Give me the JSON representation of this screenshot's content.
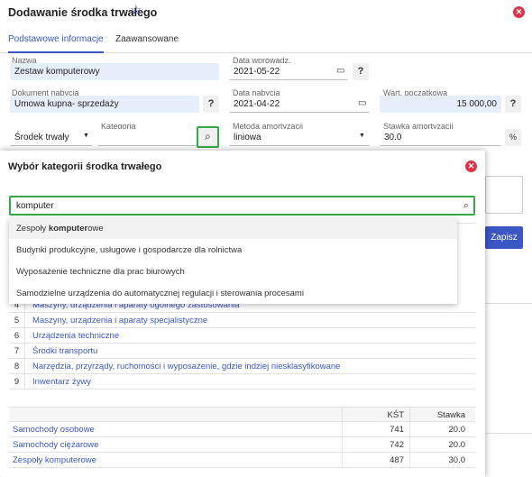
{
  "header": {
    "title": "Dodawanie środka trwałego"
  },
  "tabs": [
    "Podstawowe informacje",
    "Zaawansowane"
  ],
  "form": {
    "nazwa": {
      "label": "Nazwa",
      "value": "Zestaw komputerowy"
    },
    "data_wprowadz": {
      "label": "Data wprowadz.",
      "value": "2021-05-22"
    },
    "dokument": {
      "label": "Dokument nabycia",
      "value": "Umowa kupna- sprzedaży"
    },
    "data_nabycia": {
      "label": "Data nabycia",
      "value": "2021-04-22"
    },
    "wart": {
      "label": "Wart. początkowa",
      "value": "15 000,00"
    },
    "typ": {
      "value": "Środek trwały"
    },
    "kategoria": {
      "label": "Kategoria",
      "value": ""
    },
    "metoda": {
      "label": "Metoda amortyzacji",
      "value": "liniowa"
    },
    "stawka": {
      "label": "Stawka amortyzacji",
      "value": "30.0",
      "unit": "%"
    },
    "question": "?"
  },
  "save_label": "Zapisz",
  "modal": {
    "title": "Wybór kategorii środka trwałego",
    "search_value": "komputer",
    "suggestions": [
      {
        "prefix": "Zespoły ",
        "match": "komputer",
        "suffix": "owe"
      },
      {
        "prefix": "Budynki produkcyjne, usługowe i gospodarcze dla rolnictwa",
        "match": "",
        "suffix": ""
      },
      {
        "prefix": "Wyposażenie techniczne dla prac biurowych",
        "match": "",
        "suffix": ""
      },
      {
        "prefix": "Samodzielne urządzenia do automatycznej regulacji i sterowania procesami",
        "match": "",
        "suffix": ""
      }
    ],
    "categories": [
      {
        "num": "4",
        "name": "Maszyny, urządzenia i aparaty ogólnego zastosowania"
      },
      {
        "num": "5",
        "name": "Maszyny, urządzenia i aparaty specjalistyczne"
      },
      {
        "num": "6",
        "name": "Urządzenia techniczne"
      },
      {
        "num": "7",
        "name": "Środki transportu"
      },
      {
        "num": "8",
        "name": "Narzędzia, przyrządy, ruchomości i wyposażenie, gdzie indziej niesklasyfikowane"
      },
      {
        "num": "9",
        "name": "Inwentarz żywy"
      }
    ],
    "results_header": {
      "kst": "KŚT",
      "stawka": "Stawka"
    },
    "results": [
      {
        "name": "Samochody osobowe",
        "kst": "741",
        "stawka": "20.0"
      },
      {
        "name": "Samochody ciężarowe",
        "kst": "742",
        "stawka": "20.0"
      },
      {
        "name": "Zespoły komputerowe",
        "kst": "487",
        "stawka": "30.0"
      }
    ]
  },
  "colors": {
    "accent": "#3a57c4",
    "highlight": "#35a94a",
    "danger": "#e0334a",
    "field_blue": "#e7eefb"
  }
}
